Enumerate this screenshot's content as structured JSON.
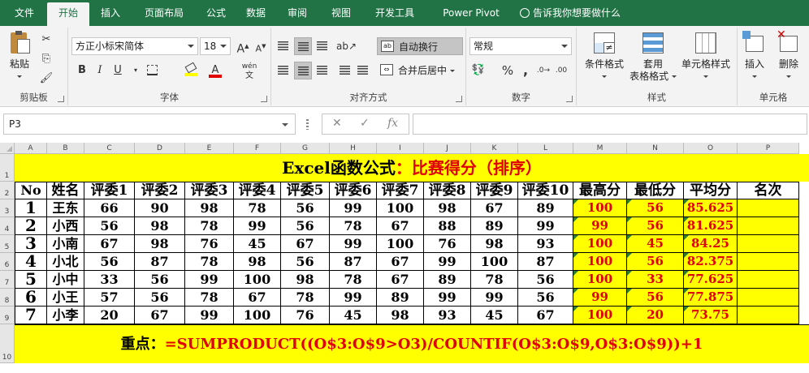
{
  "ribbon_tabs": [
    "文件",
    "开始",
    "插入",
    "页面布局",
    "公式",
    "数据",
    "审阅",
    "视图",
    "开发工具",
    "Power Pivot"
  ],
  "active_tab": "开始",
  "tell_me": "告诉我你想要做什么",
  "clipboard": {
    "paste_label": "粘贴",
    "group_label": "剪贴板"
  },
  "font": {
    "name": "方正小标宋简体",
    "size": "18",
    "group_label": "字体",
    "bold": "B",
    "italic": "I",
    "underline": "U",
    "grow": "A",
    "shrink": "A",
    "font_color": "A",
    "phonetic": "wén"
  },
  "alignment": {
    "wrap_label": "自动换行",
    "merge_label": "合并后居中",
    "group_label": "对齐方式"
  },
  "number": {
    "format": "常规",
    "percent": "%",
    "comma": ",",
    "group_label": "数字"
  },
  "styles": {
    "cond_format": "条件格式",
    "table_format_1": "套用",
    "table_format_2": "表格格式",
    "cell_styles": "单元格样式",
    "group_label": "样式"
  },
  "cells": {
    "insert": "插入",
    "delete": "删除",
    "group_label": "单元格"
  },
  "formula_bar": {
    "name_box": "P3",
    "cancel": "✕",
    "enter": "✓",
    "fx": "fx",
    "formula": ""
  },
  "columns": [
    "A",
    "B",
    "C",
    "D",
    "E",
    "F",
    "G",
    "H",
    "I",
    "J",
    "K",
    "L",
    "M",
    "N",
    "O",
    "P"
  ],
  "rows": [
    "1",
    "2",
    "3",
    "4",
    "5",
    "6",
    "7",
    "8",
    "9",
    "10"
  ],
  "title": {
    "part1": "Excel函数公式",
    "part2": "：比赛得分（排序）"
  },
  "headers": [
    "No",
    "姓名",
    "评委1",
    "评委2",
    "评委3",
    "评委4",
    "评委5",
    "评委6",
    "评委7",
    "评委8",
    "评委9",
    "评委10",
    "最高分",
    "最低分",
    "平均分",
    "名次"
  ],
  "table": [
    [
      "1",
      "王东",
      "66",
      "90",
      "98",
      "78",
      "56",
      "99",
      "100",
      "98",
      "67",
      "89",
      "100",
      "56",
      "85.625",
      ""
    ],
    [
      "2",
      "小西",
      "56",
      "98",
      "78",
      "99",
      "56",
      "78",
      "67",
      "88",
      "89",
      "99",
      "99",
      "56",
      "81.625",
      ""
    ],
    [
      "3",
      "小南",
      "67",
      "98",
      "76",
      "45",
      "67",
      "99",
      "100",
      "76",
      "98",
      "93",
      "100",
      "45",
      "84.25",
      ""
    ],
    [
      "4",
      "小北",
      "56",
      "87",
      "78",
      "98",
      "56",
      "87",
      "67",
      "99",
      "100",
      "87",
      "100",
      "56",
      "82.375",
      ""
    ],
    [
      "5",
      "小中",
      "33",
      "56",
      "99",
      "100",
      "98",
      "78",
      "67",
      "89",
      "78",
      "56",
      "100",
      "33",
      "77.625",
      ""
    ],
    [
      "6",
      "小王",
      "57",
      "56",
      "78",
      "67",
      "78",
      "99",
      "89",
      "99",
      "99",
      "56",
      "99",
      "56",
      "77.875",
      ""
    ],
    [
      "7",
      "小李",
      "20",
      "67",
      "99",
      "100",
      "76",
      "45",
      "98",
      "93",
      "45",
      "67",
      "100",
      "20",
      "73.75",
      ""
    ]
  ],
  "note": {
    "label": "重点：",
    "formula": "=SUMPRODUCT((O$3:O$9>O3)/COUNTIF(O$3:O$9,O$3:O$9))+1"
  }
}
